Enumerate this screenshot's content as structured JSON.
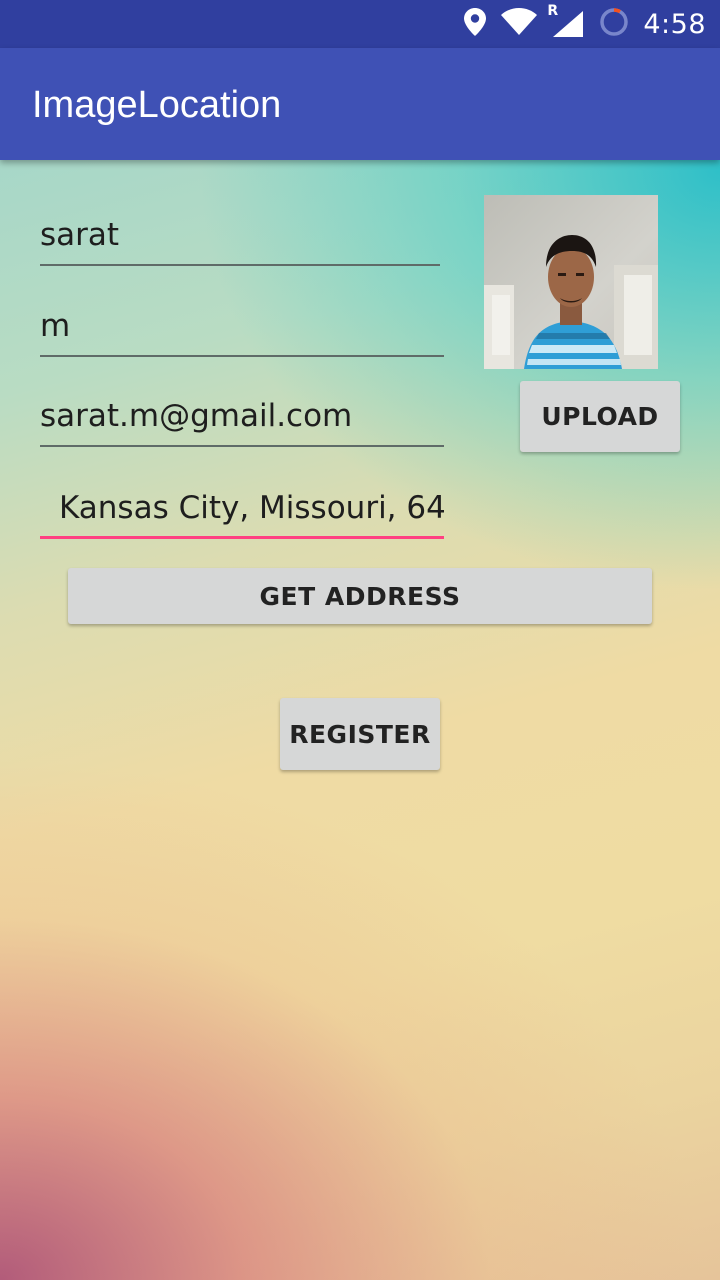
{
  "status_bar": {
    "time": "4:58",
    "icons": [
      "location-icon",
      "wifi-icon",
      "signal-roaming-icon",
      "battery-charging-icon"
    ],
    "roaming_label": "R"
  },
  "app_bar": {
    "title": "ImageLocation"
  },
  "form": {
    "first_name_value": "sarat",
    "last_name_value": "m",
    "email_value": "sarat.m@gmail.com",
    "address_value": "Kansas City, Missouri, 64"
  },
  "buttons": {
    "upload_label": "UPLOAD",
    "get_address_label": "GET ADDRESS",
    "register_label": "REGISTER"
  },
  "colors": {
    "status_bar": "#303F9F",
    "app_bar": "#3F51B5",
    "accent": "#FF4081",
    "button": "#D6D7D7"
  }
}
